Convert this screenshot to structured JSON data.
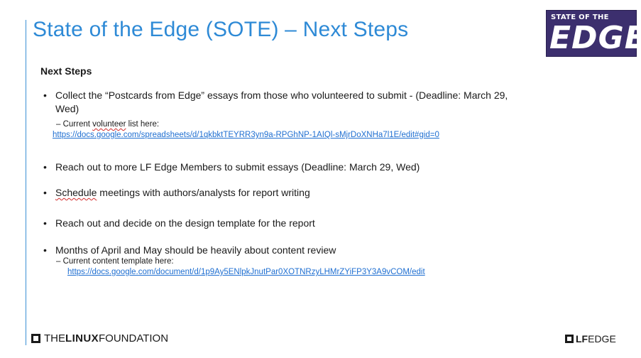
{
  "slide": {
    "title": "State of the Edge (SOTE) – Next Steps",
    "logo": {
      "small": "STATE OF THE",
      "big": "EDGE"
    },
    "heading": "Next Steps",
    "bullets": [
      {
        "line1": "Collect the “Postcards from Edge” essays from those who volunteered to submit  - (Deadline: March 29,",
        "line2": "Wed)",
        "sub_prefix": "–  Current ",
        "sub_flagged": "volunteer",
        "sub_suffix": " list here:",
        "link": "https://docs.google.com/spreadsheets/d/1qkbktTEYRR3yn9a-RPGhNP-1AIQl-sMjrDoXNHa7l1E/edit#gid=0"
      },
      {
        "text": "Reach out to more LF Edge Members to submit essays (Deadline: March 29, Wed)"
      },
      {
        "flagged": "Schedule",
        "rest": " meetings with authors/analysts for report writing"
      },
      {
        "text": "Reach out and decide on the design template for the report"
      },
      {
        "text": "Months of April and May should be heavily about content review",
        "sub": "–  Current content template here:",
        "link": "https://docs.google.com/document/d/1p9Ay5ENlpkJnutPar0XOTNRzyLHMrZYiFP3Y3A9vCOM/edit"
      }
    ],
    "bullet_glyph": "•",
    "footer_left": {
      "pre": "THE",
      "bold": "LINUX",
      "post": " FOUNDATION"
    },
    "footer_right": {
      "bold": "LF",
      "post": "EDGE"
    },
    "colors": {
      "title": "#2e8ad6",
      "link": "#1f6fd1",
      "logo_bg": "#3c2f6e",
      "accent": "#3a8fd4"
    }
  }
}
